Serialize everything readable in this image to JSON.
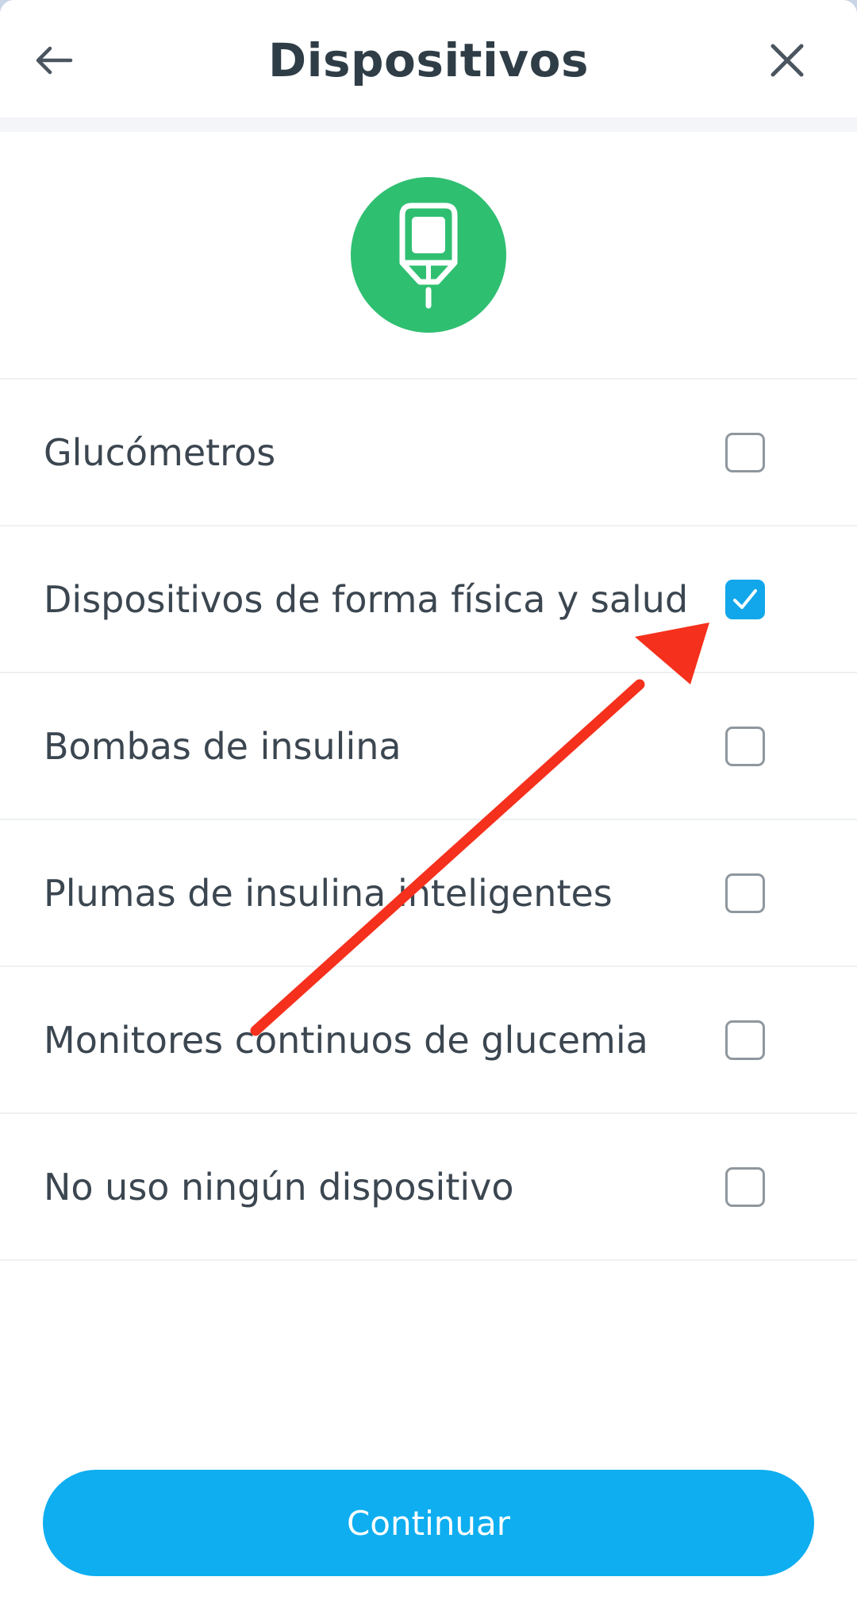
{
  "header": {
    "title": "Dispositivos",
    "back_icon": "arrow-left-icon",
    "close_icon": "close-icon"
  },
  "hero": {
    "icon": "glucometer-icon",
    "badge_color": "#2fbf71"
  },
  "options": [
    {
      "label": "Glucómetros",
      "checked": false
    },
    {
      "label": "Dispositivos de forma física y salud",
      "checked": true
    },
    {
      "label": "Bombas de insulina",
      "checked": false
    },
    {
      "label": "Plumas de insulina inteligentes",
      "checked": false
    },
    {
      "label": "Monitores continuos de glucemia",
      "checked": false
    },
    {
      "label": "No uso ningún dispositivo",
      "checked": false
    }
  ],
  "footer": {
    "continue_label": "Continuar",
    "accent_color": "#0eaef0"
  },
  "annotation": {
    "type": "arrow",
    "color": "#f5301c",
    "points_to": "Dispositivos de forma física y salud"
  }
}
